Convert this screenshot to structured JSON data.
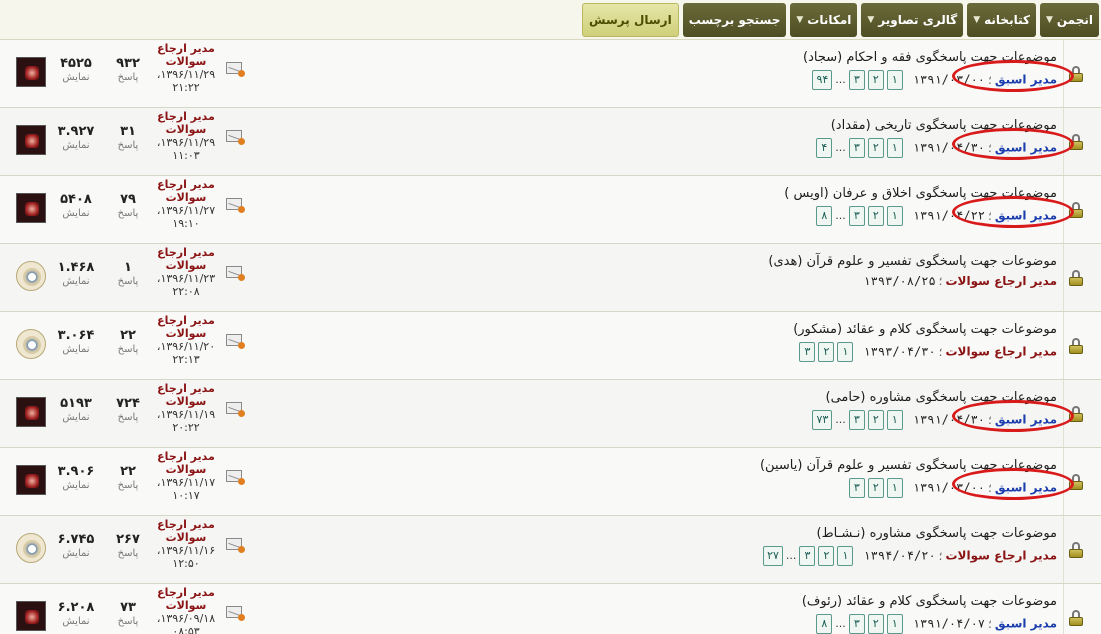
{
  "nav": {
    "items": [
      {
        "label": "انجمن",
        "dropdown": true
      },
      {
        "label": "کتابخانه",
        "dropdown": true
      },
      {
        "label": "گالری تصاویر",
        "dropdown": true
      },
      {
        "label": "امکانات",
        "dropdown": true
      },
      {
        "label": "جستجو برچسب",
        "dropdown": false
      },
      {
        "label": "ارسال پرسش",
        "dropdown": false,
        "accent": true
      }
    ],
    "caret": "▼"
  },
  "labels": {
    "meta_separator": "؛",
    "replies": "پاسخ",
    "views": "نمایش",
    "dots": "..."
  },
  "colors": {
    "highlight_oval": "#d81a1a",
    "author_blue": "#1c3fae",
    "author_red": "#8b1414",
    "page_chip_border": "#5a9a8c"
  },
  "threads": [
    {
      "title": "موضوعات جهت پاسخگوی فقه و احکام (سجاد)",
      "author": "مدیر اسبق",
      "author_color": "blue",
      "date": "۱۳۹۱/۰۳/۰۰",
      "pages": [
        "۱",
        "۲",
        "۳",
        "...",
        "۹۴"
      ],
      "highlighted": true,
      "last_poster": "مدیر ارجاع سوالات",
      "last_date": "۱۳۹۶/۱۱/۲۹، ۲۱:۲۲",
      "replies": "۹۳۲",
      "views": "۴۵۲۵",
      "avatar": "portrait-icon"
    },
    {
      "title": "موضوعات جهت پاسخگوی تاریخی (مقداد)",
      "author": "مدیر اسبق",
      "author_color": "blue",
      "date": "۱۳۹۱/۰۴/۳۰",
      "pages": [
        "۱",
        "۲",
        "۳",
        "...",
        "۴"
      ],
      "highlighted": true,
      "last_poster": "مدیر ارجاع سوالات",
      "last_date": "۱۳۹۶/۱۱/۲۹، ۱۱:۰۳",
      "replies": "۳۱",
      "views": "۳.۹۲۷",
      "avatar": "portrait-icon"
    },
    {
      "title": "موضوعات جهت پاسخگوی اخلاق و عرفان (اویس )",
      "author": "مدیر اسبق",
      "author_color": "blue",
      "date": "۱۳۹۱/۰۴/۲۲",
      "pages": [
        "۱",
        "۲",
        "۳",
        "...",
        "۸"
      ],
      "highlighted": true,
      "last_poster": "مدیر ارجاع سوالات",
      "last_date": "۱۳۹۶/۱۱/۲۷، ۱۹:۱۰",
      "replies": "۷۹",
      "views": "۵۴۰۸",
      "avatar": "portrait-icon"
    },
    {
      "title": "موضوعات جهت پاسخگوی تفسیر و علوم قرآن (هدی)",
      "author": "مدیر ارجاع سوالات",
      "author_color": "red",
      "date": "۱۳۹۳/۰۸/۲۵",
      "pages": [],
      "highlighted": false,
      "last_poster": "مدیر ارجاع سوالات",
      "last_date": "۱۳۹۶/۱۱/۲۳، ۲۲:۰۸",
      "replies": "۱",
      "views": "۱.۴۶۸",
      "avatar": "seal-icon"
    },
    {
      "title": "موضوعات جهت پاسخگوی کلام و عقائد (مشکور)",
      "author": "مدیر ارجاع سوالات",
      "author_color": "red",
      "date": "۱۳۹۳/۰۴/۳۰",
      "pages": [
        "۱",
        "۲",
        "۳"
      ],
      "highlighted": false,
      "last_poster": "مدیر ارجاع سوالات",
      "last_date": "۱۳۹۶/۱۱/۲۰، ۲۲:۱۳",
      "replies": "۲۲",
      "views": "۳.۰۶۴",
      "avatar": "seal-icon"
    },
    {
      "title": "موضوعات جهت پاسخگوی مشاوره (حامی)",
      "author": "مدیر اسبق",
      "author_color": "blue",
      "date": "۱۳۹۱/۰۴/۳۰",
      "pages": [
        "۱",
        "۲",
        "۳",
        "...",
        "۷۳"
      ],
      "highlighted": true,
      "last_poster": "مدیر ارجاع سوالات",
      "last_date": "۱۳۹۶/۱۱/۱۹، ۲۰:۲۲",
      "replies": "۷۲۴",
      "views": "۵۱۹۳",
      "avatar": "portrait-icon"
    },
    {
      "title": "موضوعات جهت پاسخگوی تفسیر و علوم قرآن (یاسین)",
      "author": "مدیر اسبق",
      "author_color": "blue",
      "date": "۱۳۹۱/۰۳/۰۰",
      "pages": [
        "۱",
        "۲",
        "۳"
      ],
      "highlighted": true,
      "last_poster": "مدیر ارجاع سوالات",
      "last_date": "۱۳۹۶/۱۱/۱۷، ۱۰:۱۷",
      "replies": "۲۲",
      "views": "۳.۹۰۶",
      "avatar": "portrait-icon"
    },
    {
      "title": "موضوعات جهت پاسخگوی مشاوره (نـشـاط)",
      "author": "مدیر ارجاع سوالات",
      "author_color": "red",
      "date": "۱۳۹۴/۰۴/۲۰",
      "pages": [
        "۱",
        "۲",
        "۳",
        "...",
        "۲۷"
      ],
      "highlighted": false,
      "last_poster": "مدیر ارجاع سوالات",
      "last_date": "۱۳۹۶/۱۱/۱۶، ۱۲:۵۰",
      "replies": "۲۶۷",
      "views": "۶.۷۴۵",
      "avatar": "seal-icon"
    },
    {
      "title": "موضوعات جهت پاسخگوی کلام و عقائد (رئوف)",
      "author": "مدیر اسبق",
      "author_color": "blue",
      "date": "۱۳۹۱/۰۴/۰۷",
      "pages": [
        "۱",
        "۲",
        "۳",
        "...",
        "۸"
      ],
      "highlighted": false,
      "last_poster": "مدیر ارجاع سوالات",
      "last_date": "۱۳۹۶/۰۹/۱۸، ۰۸:۵۳",
      "replies": "۷۳",
      "views": "۶.۲۰۸",
      "avatar": "portrait-icon"
    }
  ]
}
